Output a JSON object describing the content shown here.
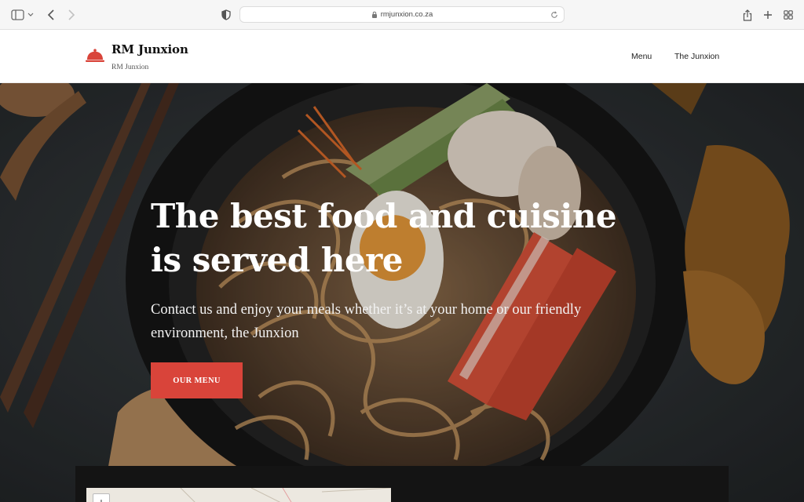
{
  "browser": {
    "url": "rmjunxion.co.za"
  },
  "site": {
    "title": "RM Junxion",
    "tagline": "RM Junxion",
    "nav": [
      {
        "label": "Menu"
      },
      {
        "label": "The Junxion"
      }
    ]
  },
  "hero": {
    "title": "The best food and cuisine is served here",
    "subtitle": "Contact us and enjoy your meals whether it’s at your home or our friendly environment, the Junxion",
    "cta_label": "OUR MENU"
  },
  "map": {
    "zoom_in_label": "+"
  },
  "colors": {
    "accent": "#d9443a",
    "logo": "#d9443a"
  }
}
